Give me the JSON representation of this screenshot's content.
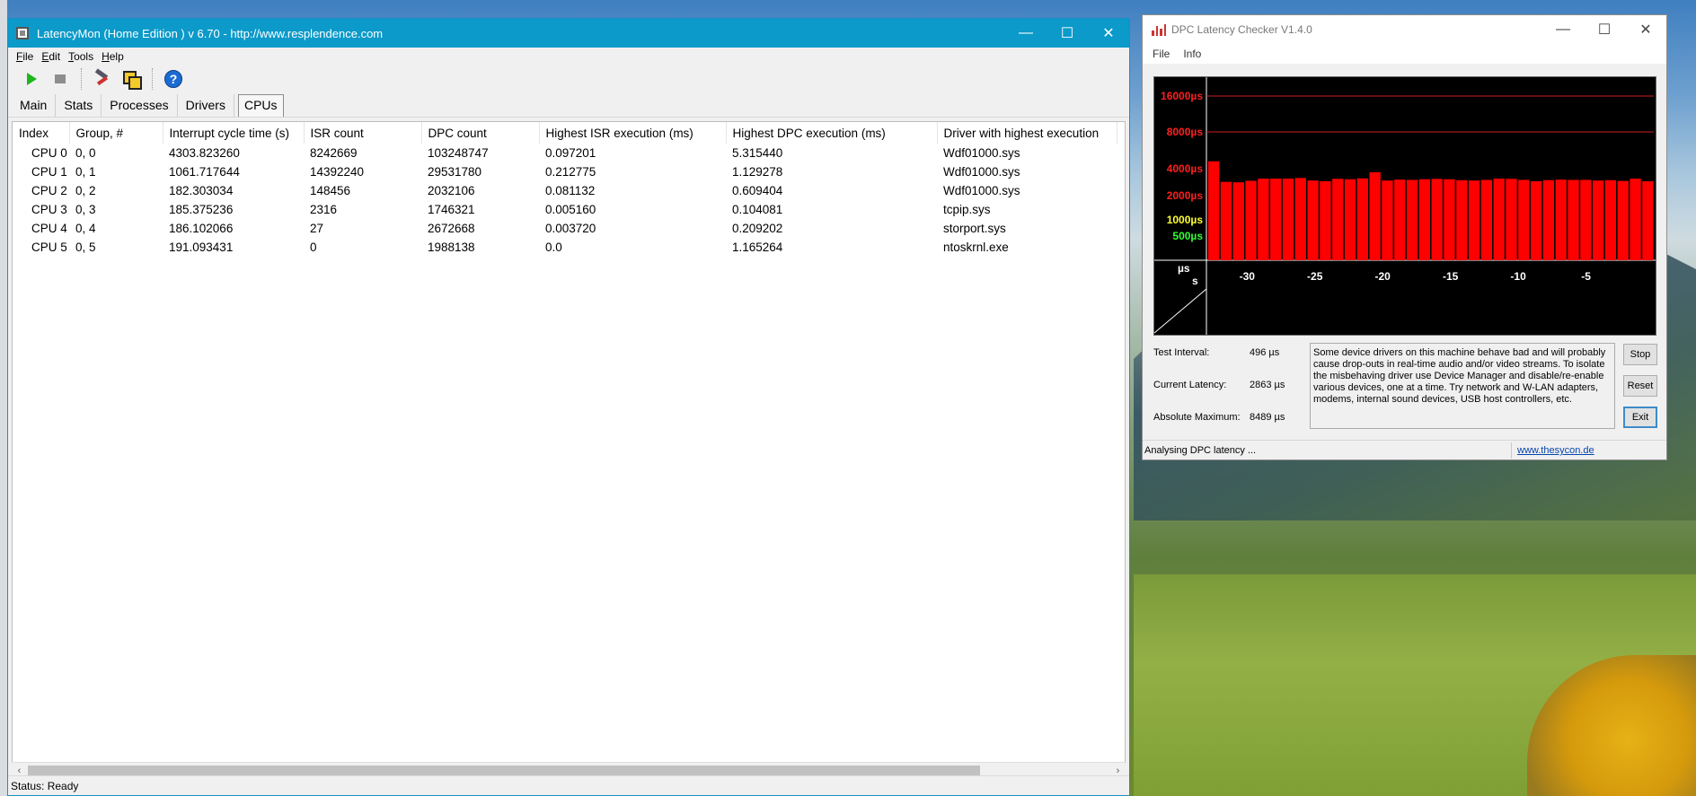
{
  "latencymon": {
    "title": "LatencyMon  (Home Edition )  v 6.70 - http://www.resplendence.com",
    "caption": {
      "minimize": "—",
      "maximize": "☐",
      "close": "✕"
    },
    "menu": [
      {
        "key": "F",
        "rest": "ile"
      },
      {
        "key": "E",
        "rest": "dit"
      },
      {
        "key": "T",
        "rest": "ools"
      },
      {
        "key": "H",
        "rest": "elp"
      }
    ],
    "toolbar_icons": [
      "play-icon",
      "stop-icon",
      "tools-icon",
      "windows-icon",
      "help-icon"
    ],
    "help_glyph": "?",
    "tabs": [
      "Main",
      "Stats",
      "Processes",
      "Drivers",
      "CPUs"
    ],
    "active_tab": "CPUs",
    "columns": [
      "Index",
      "Group, #",
      "Interrupt cycle time (s)",
      "ISR count",
      "DPC count",
      "Highest ISR execution (ms)",
      "Highest DPC execution (ms)",
      "Driver with highest execution"
    ],
    "rows": [
      [
        "CPU 0",
        "0, 0",
        "4303.823260",
        "8242669",
        "103248747",
        "0.097201",
        "5.315440",
        "Wdf01000.sys"
      ],
      [
        "CPU 1",
        "0, 1",
        "1061.717644",
        "14392240",
        "29531780",
        "0.212775",
        "1.129278",
        "Wdf01000.sys"
      ],
      [
        "CPU 2",
        "0, 2",
        "182.303034",
        "148456",
        "2032106",
        "0.081132",
        "0.609404",
        "Wdf01000.sys"
      ],
      [
        "CPU 3",
        "0, 3",
        "185.375236",
        "2316",
        "1746321",
        "0.005160",
        "0.104081",
        "tcpip.sys"
      ],
      [
        "CPU 4",
        "0, 4",
        "186.102066",
        "27",
        "2672668",
        "0.003720",
        "0.209202",
        "storport.sys"
      ],
      [
        "CPU 5",
        "0, 5",
        "191.093431",
        "0",
        "1988138",
        "0.0",
        "1.165264",
        "ntoskrnl.exe"
      ]
    ],
    "scroll_left": "‹",
    "scroll_right": "›",
    "status": "Status: Ready"
  },
  "dpc": {
    "title": "DPC Latency Checker V1.4.0",
    "caption": {
      "minimize": "—",
      "maximize": "☐",
      "close": "✕"
    },
    "menu": [
      "File",
      "Info"
    ],
    "chart_data": {
      "type": "bar",
      "y_scale": "nonlinear",
      "ylabels": [
        {
          "text": "16000µs",
          "value": 16000,
          "color": "#ff1f1f"
        },
        {
          "text": "8000µs",
          "value": 8000,
          "color": "#ff1f1f"
        },
        {
          "text": "4000µs",
          "value": 4000,
          "color": "#ff1f1f"
        },
        {
          "text": "2000µs",
          "value": 2000,
          "color": "#ff1f1f"
        },
        {
          "text": "1000µs",
          "value": 1000,
          "color": "#ffff33"
        },
        {
          "text": "500µs",
          "value": 500,
          "color": "#33ff33"
        }
      ],
      "gridlines": [
        16000,
        8000
      ],
      "corner_y": "µs",
      "corner_x": "s",
      "xticks": [
        -30,
        -25,
        -20,
        -15,
        -10,
        -5
      ],
      "x_range": [
        -33,
        0
      ],
      "bar_color": "#ff0000",
      "values": [
        4600,
        2850,
        2820,
        2930,
        3100,
        3100,
        3100,
        3150,
        2950,
        2900,
        3080,
        3050,
        3120,
        3650,
        2950,
        3020,
        3000,
        3050,
        3080,
        3050,
        2980,
        2950,
        3000,
        3100,
        3080,
        3000,
        2900,
        2980,
        3020,
        3000,
        3000,
        2950,
        2980,
        2920,
        3100,
        2900
      ]
    },
    "test_interval_label": "Test Interval:",
    "test_interval_value": "496 µs",
    "current_latency_label": "Current Latency:",
    "current_latency_value": "2863 µs",
    "absolute_max_label": "Absolute Maximum:",
    "absolute_max_value": "8489 µs",
    "message": "Some device drivers on this machine behave bad and will probably cause drop-outs in real-time audio and/or video streams. To isolate the misbehaving driver use Device Manager and disable/re-enable various devices, one at a time. Try network and W-LAN adapters, modems, internal sound devices, USB host controllers, etc.",
    "buttons": {
      "stop": "Stop",
      "reset": "Reset",
      "exit": "Exit"
    },
    "status": "Analysing DPC latency ...",
    "link": "www.thesycon.de"
  }
}
